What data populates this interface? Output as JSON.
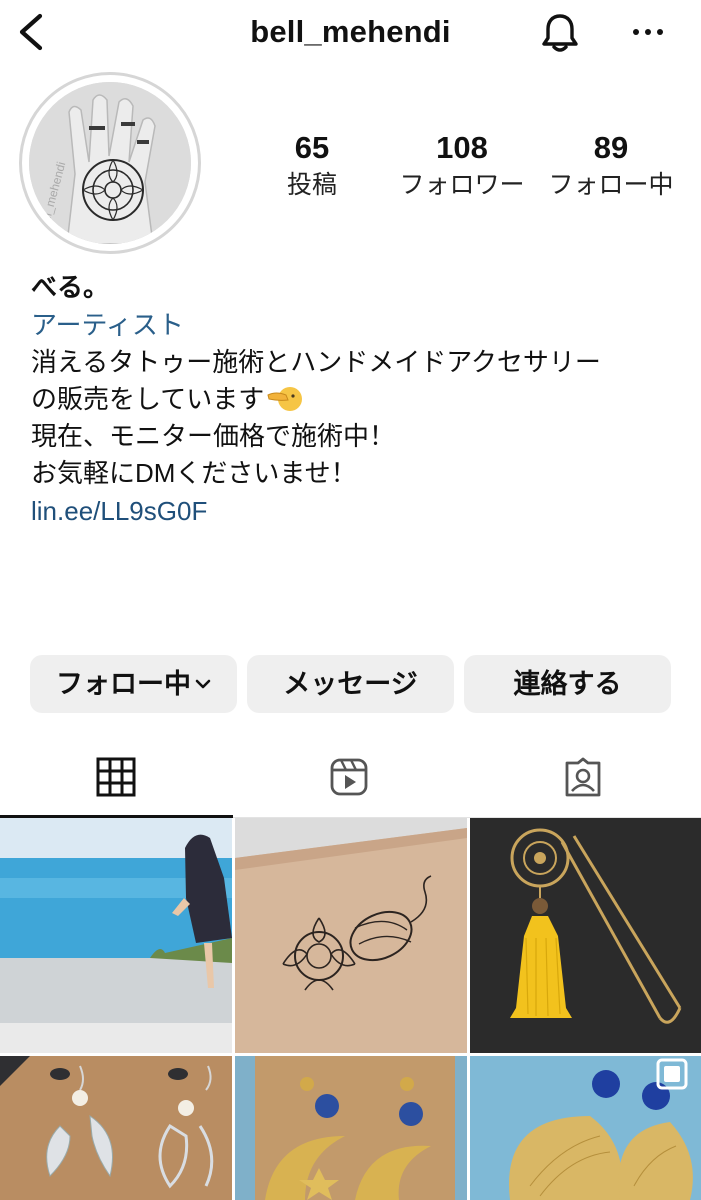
{
  "header": {
    "username": "bell_mehendi",
    "icons": [
      "back-icon",
      "bell-icon",
      "more-icon"
    ]
  },
  "avatar": {
    "watermark": "bell_mehendi"
  },
  "stats": {
    "posts": {
      "count": "65",
      "label": "投稿"
    },
    "followers": {
      "count": "108",
      "label": "フォロワー"
    },
    "following": {
      "count": "89",
      "label": "フォロー中"
    }
  },
  "bio": {
    "name": "べる。",
    "category": "アーティスト",
    "line1": "消えるタトゥー施術とハンドメイドアクセサリー",
    "line2": "の販売をしています",
    "line3": "現在、モニター価格で施術中！",
    "line4": "お気軽にDMくださいませ！",
    "link": "lin.ee/LL9sG0F"
  },
  "buttons": {
    "following": "フォロー中",
    "message": "メッセージ",
    "contact": "連絡する"
  },
  "tabs": [
    "grid-icon",
    "reels-icon",
    "tagged-icon"
  ],
  "colors": {
    "link": "#1f4f7a",
    "category": "#2a5f8a",
    "button_bg": "#efefef"
  }
}
